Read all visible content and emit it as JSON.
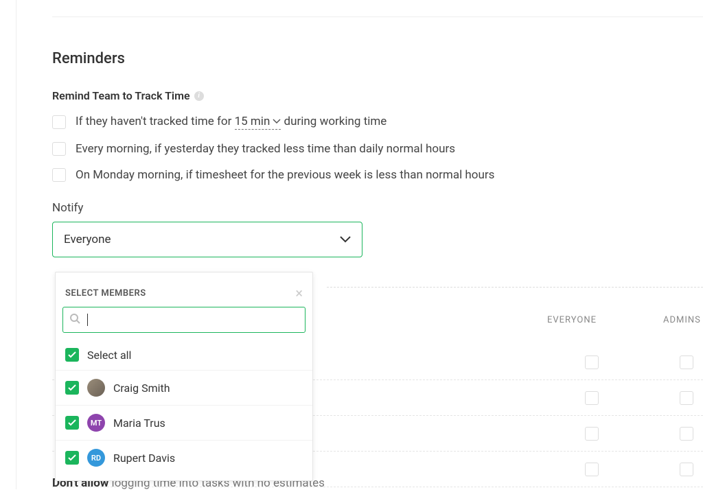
{
  "section": {
    "title": "Reminders",
    "remind_label": "Remind Team to Track Time",
    "options": {
      "opt1_pre": "If they haven't tracked time for ",
      "opt1_value": "15 min",
      "opt1_post": " during working time",
      "opt2": "Every morning, if yesterday they tracked less time than daily normal hours",
      "opt3": "On Monday morning, if timesheet for the previous week is less than normal hours"
    },
    "notify_label": "Notify",
    "notify_value": "Everyone"
  },
  "dropdown": {
    "header": "SELECT MEMBERS",
    "search_placeholder": "",
    "select_all": "Select all",
    "members": [
      {
        "name": "Craig Smith",
        "initials": "",
        "avatar_class": "photo",
        "checked": true
      },
      {
        "name": "Maria Trus",
        "initials": "MT",
        "avatar_class": "mt",
        "checked": true
      },
      {
        "name": "Rupert Davis",
        "initials": "RD",
        "avatar_class": "rd",
        "checked": true
      }
    ]
  },
  "permissions": {
    "col1": "EVERYONE",
    "col2": "ADMINS"
  },
  "cutoff": {
    "bold": "Don't allow",
    "rest": " logging time into tasks with no estimates"
  }
}
